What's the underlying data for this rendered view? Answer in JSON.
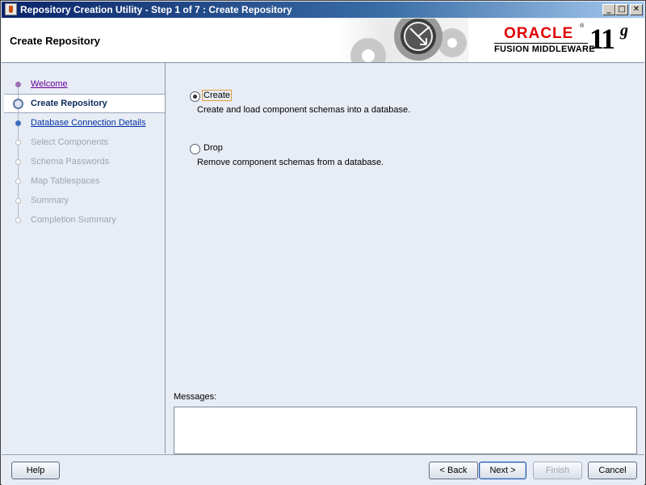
{
  "window": {
    "title": "Repository Creation Utility - Step 1 of 7 : Create Repository",
    "controls": {
      "minimize": "_",
      "maximize": "□",
      "close": "✕"
    }
  },
  "header": {
    "page_title": "Create Repository",
    "logo": {
      "brand": "ORACLE",
      "registered": "®",
      "product": "FUSION MIDDLEWARE",
      "version": "11",
      "version_suffix": "g"
    }
  },
  "sidebar": {
    "steps": [
      {
        "label": "Welcome",
        "state": "visited"
      },
      {
        "label": "Create Repository",
        "state": "current"
      },
      {
        "label": "Database Connection Details",
        "state": "link"
      },
      {
        "label": "Select Components",
        "state": "disabled"
      },
      {
        "label": "Schema Passwords",
        "state": "disabled"
      },
      {
        "label": "Map Tablespaces",
        "state": "disabled"
      },
      {
        "label": "Summary",
        "state": "disabled"
      },
      {
        "label": "Completion Summary",
        "state": "disabled"
      }
    ]
  },
  "main": {
    "options": [
      {
        "label": "Create",
        "description": "Create and load component schemas into a database.",
        "selected": true
      },
      {
        "label": "Drop",
        "description": "Remove component schemas from a database.",
        "selected": false
      }
    ],
    "messages_label": "Messages:",
    "messages_text": ""
  },
  "buttons": {
    "help": "Help",
    "back": "< Back",
    "next": "Next >",
    "finish": "Finish",
    "cancel": "Cancel"
  },
  "colors": {
    "title_bar": "#0a246a",
    "panel_bg": "#e8ecf4",
    "oracle_red": "#e00000",
    "visited_link": "#660099",
    "link": "#0033aa"
  }
}
